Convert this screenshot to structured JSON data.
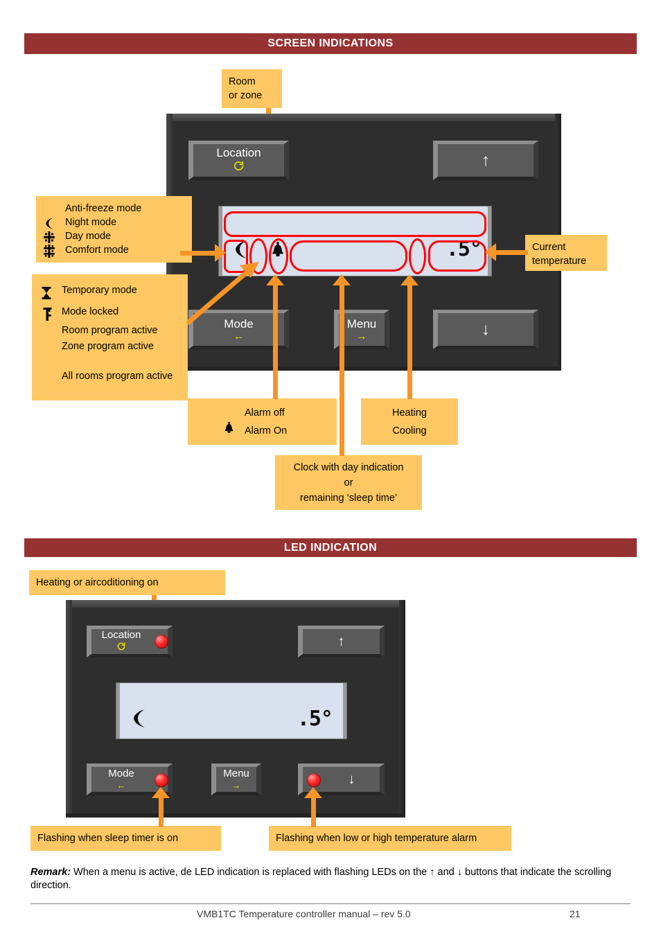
{
  "colors": {
    "header_bar": "#963232",
    "callout": "#fdc863",
    "connector": "#f79428",
    "annotation": "#fe0000",
    "device_body": "#2e2e2e",
    "lcd": "#d9e1ef",
    "led": "#ff2b2b",
    "key_hint": "#f2e600"
  },
  "sections": {
    "screen_indications": {
      "title": "SCREEN INDICATIONS"
    },
    "led_indication": {
      "title": "LED INDICATION"
    }
  },
  "screen_section": {
    "callout_room": {
      "line1": "Room",
      "line2": "or zone"
    },
    "callout_modes": {
      "rows": [
        {
          "symbol": "",
          "label": "Anti-freeze mode"
        },
        {
          "symbol": "☾",
          "label": "Night mode"
        },
        {
          "symbol": "✳",
          "label": "Day mode"
        },
        {
          "symbol": "❇",
          "label": "Comfort mode"
        }
      ]
    },
    "callout_programs": {
      "rows": [
        {
          "symbol": "⧗",
          "label": "Temporary mode"
        },
        {
          "symbol": "⚷",
          "label": "Mode locked"
        },
        {
          "symbol": "",
          "label": "Room program active"
        },
        {
          "symbol": "",
          "label": "Zone program active"
        },
        {
          "symbol": "",
          "label": "All rooms program active"
        }
      ]
    },
    "callout_current_temp": {
      "line1": "Current",
      "line2": "temperature"
    },
    "callout_alarm": {
      "rows": [
        {
          "symbol": "",
          "label": "Alarm off"
        },
        {
          "symbol": "🔔",
          "label": "Alarm On"
        }
      ]
    },
    "callout_heatcool": {
      "line1": "Heating",
      "line2": "Cooling"
    },
    "callout_clock": {
      "line1": "Clock with day indication",
      "line2": "or",
      "line3": "remaining ‘sleep time’"
    },
    "device": {
      "keys": {
        "location": {
          "label": "Location",
          "hint_icon": "rotate-ccw-icon"
        },
        "up": {
          "label": "",
          "arrow": "↑"
        },
        "mode": {
          "label": "Mode",
          "arrow_hint": "←"
        },
        "menu": {
          "label": "Menu",
          "arrow_hint": "→"
        },
        "down": {
          "label": "",
          "arrow": "↓"
        }
      },
      "lcd": {
        "line1": "",
        "mode_glyph": "night-mode-moon",
        "alarm_glyph": "alarm-bell",
        "clock": "",
        "temperature": ".5°"
      }
    }
  },
  "led_section": {
    "callout_heating": {
      "text": "Heating or aircoditioning on"
    },
    "callout_sleep": {
      "text": "Flashing when sleep timer is on"
    },
    "callout_alarm": {
      "text": "Flashing when low or high temperature alarm"
    },
    "device": {
      "keys": {
        "location": {
          "label": "Location",
          "hint_icon": "rotate-ccw-icon",
          "led": true
        },
        "up": {
          "arrow": "↑",
          "led": false
        },
        "mode": {
          "label": "Mode",
          "arrow_hint": "←",
          "led": true
        },
        "menu": {
          "label": "Menu",
          "arrow_hint": "→",
          "led": false
        },
        "down": {
          "arrow": "↓",
          "led": true
        }
      },
      "lcd": {
        "mode_glyph": "night-mode-moon",
        "temperature": ".5°"
      }
    }
  },
  "remark": {
    "label": "Remark:",
    "text": " When a menu is active, de LED indication is replaced with flashing LEDs on the ↑ and ↓ buttons that indicate the scrolling direction."
  },
  "footer": {
    "title": "VMB1TC Temperature controller manual – rev 5.0",
    "page_number": "21"
  }
}
